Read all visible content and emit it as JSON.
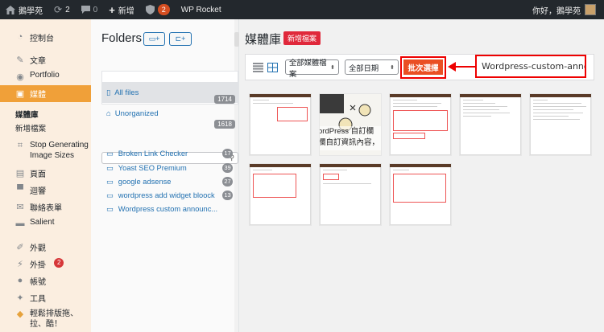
{
  "adminbar": {
    "site_name": "鵝學苑",
    "updates_count": "2",
    "comments_count": "0",
    "new_label": "新增",
    "plugin_badge": "2",
    "wp_rocket": "WP Rocket",
    "greeting": "你好，鵝學苑"
  },
  "sidebar": {
    "items": [
      {
        "label": "控制台"
      },
      {
        "label": "文章"
      },
      {
        "label": "Portfolio"
      },
      {
        "label": "媒體"
      },
      {
        "label": "媒體庫"
      },
      {
        "label": "新增檔案"
      },
      {
        "label": "Stop Generating Image Sizes"
      },
      {
        "label": "頁面"
      },
      {
        "label": "迴響"
      },
      {
        "label": "聯絡表單"
      },
      {
        "label": "Salient"
      },
      {
        "label": "外觀"
      },
      {
        "label": "外掛"
      },
      {
        "label": "帳號"
      },
      {
        "label": "工具"
      },
      {
        "label": "輕鬆排版拖、拉、酷！"
      }
    ],
    "plugins_badge": "2"
  },
  "folders": {
    "title": "Folders",
    "all_files": "All files",
    "all_files_count": "1714",
    "unorganized": "Unorganized",
    "unorganized_count": "1618",
    "list": [
      {
        "name": "Broken Link Checker",
        "count": "17"
      },
      {
        "name": "Yoast SEO Premium",
        "count": "39"
      },
      {
        "name": "google adsense",
        "count": "27"
      },
      {
        "name": "wordpress add widget bloock",
        "count": "13"
      },
      {
        "name": "Wordpress custom announc...",
        "count": ""
      }
    ]
  },
  "main": {
    "title": "媒體庫",
    "add_new": "新增檔案",
    "filter_type": "全部媒體檔案",
    "filter_date": "全部日期",
    "bulk_select": "批次選擇",
    "search_value": "Wordpress-custom-annou"
  },
  "colors": {
    "accent": "#f0a039",
    "highlight_box": "#ee0000",
    "bulk_button": "#ea4f24",
    "adminbar": "#23282d"
  },
  "thumb_overlay_text": "ordPress 自訂欄 欄自訂資訊內容，"
}
